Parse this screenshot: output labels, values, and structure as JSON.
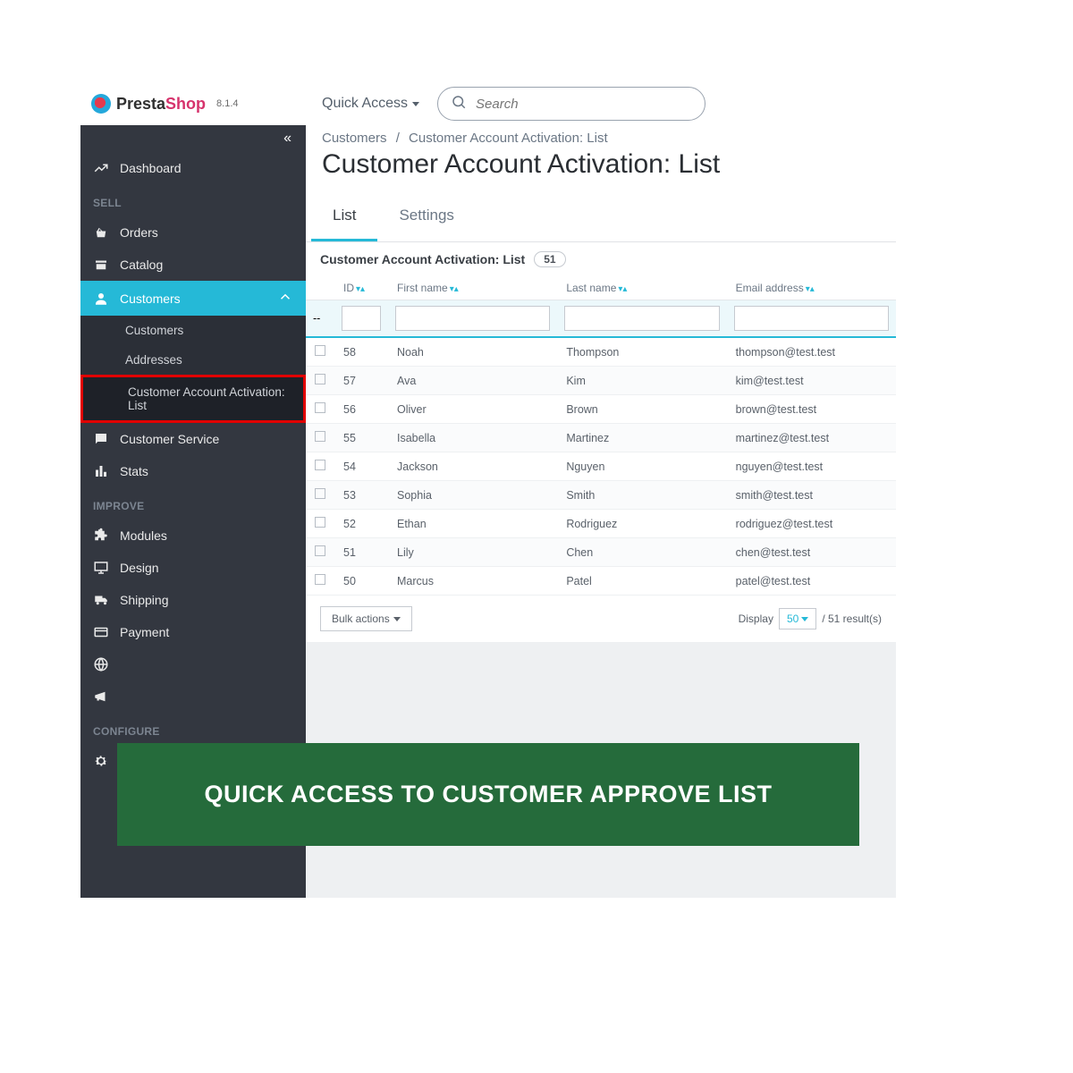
{
  "brand": {
    "name1": "Presta",
    "name2": "Shop",
    "version": "8.1.4"
  },
  "topbar": {
    "quick_access": "Quick Access",
    "search_placeholder": "Search"
  },
  "breadcrumb": {
    "a": "Customers",
    "b": "Customer Account Activation: List"
  },
  "page_title": "Customer Account Activation: List",
  "tabs": {
    "list": "List",
    "settings": "Settings"
  },
  "panel": {
    "title": "Customer Account Activation: List",
    "count": "51"
  },
  "columns": {
    "id": "ID",
    "first": "First name",
    "last": "Last name",
    "email": "Email address"
  },
  "rows": [
    {
      "id": "58",
      "first": "Noah",
      "last": "Thompson",
      "email": "thompson@test.test"
    },
    {
      "id": "57",
      "first": "Ava",
      "last": "Kim",
      "email": "kim@test.test"
    },
    {
      "id": "56",
      "first": "Oliver",
      "last": "Brown",
      "email": "brown@test.test"
    },
    {
      "id": "55",
      "first": "Isabella",
      "last": "Martinez",
      "email": "martinez@test.test"
    },
    {
      "id": "54",
      "first": "Jackson",
      "last": "Nguyen",
      "email": "nguyen@test.test"
    },
    {
      "id": "53",
      "first": "Sophia",
      "last": "Smith",
      "email": "smith@test.test"
    },
    {
      "id": "52",
      "first": "Ethan",
      "last": "Rodriguez",
      "email": "rodriguez@test.test"
    },
    {
      "id": "51",
      "first": "Lily",
      "last": "Chen",
      "email": "chen@test.test"
    },
    {
      "id": "50",
      "first": "Marcus",
      "last": "Patel",
      "email": "patel@test.test"
    }
  ],
  "footer": {
    "bulk": "Bulk actions",
    "display_label": "Display",
    "display_value": "50",
    "results_text": "/ 51 result(s)"
  },
  "sidebar": {
    "dashboard": "Dashboard",
    "sections": {
      "sell": "SELL",
      "improve": "IMPROVE",
      "configure": "CONFIGURE"
    },
    "items": {
      "orders": "Orders",
      "catalog": "Catalog",
      "customers": "Customers",
      "customers_sub": "Customers",
      "addresses": "Addresses",
      "caa": "Customer Account Activation: List",
      "customer_service": "Customer Service",
      "stats": "Stats",
      "modules": "Modules",
      "design": "Design",
      "shipping": "Shipping",
      "payment": "Payment",
      "shop_params": "Shop Parameters"
    }
  },
  "banner": "QUICK ACCESS TO CUSTOMER APPROVE LIST"
}
